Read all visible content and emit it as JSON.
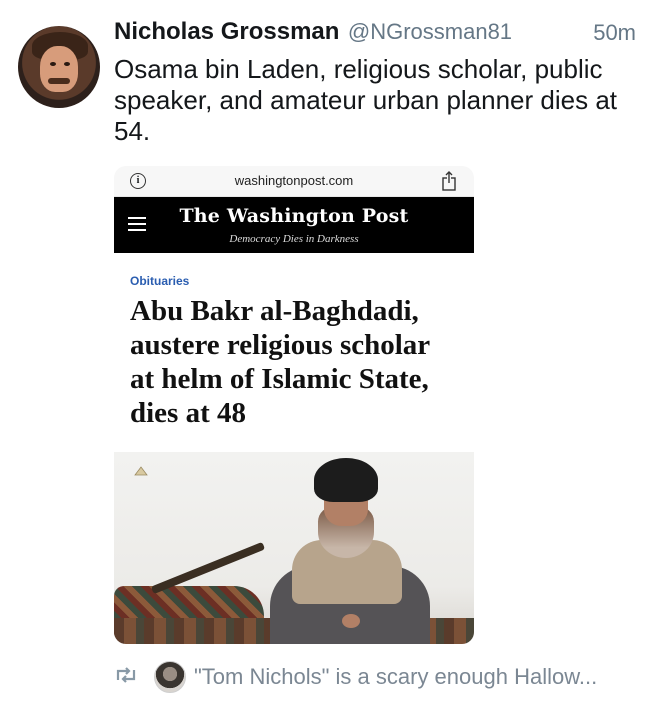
{
  "tweet": {
    "author_name": "Nicholas Grossman",
    "author_handle": "@NGrossman81",
    "timestamp": "50m",
    "text": "Osama bin Laden, religious scholar, public speaker, and amateur urban planner dies at 54."
  },
  "embedded_screenshot": {
    "browser_url": "washingtonpost.com",
    "masthead": "The Washington Post",
    "tagline": "Democracy Dies in Darkness",
    "section": "Obituaries",
    "headline": "Abu Bakr al-Baghdadi, austere religious scholar at helm of Islamic State, dies at 48"
  },
  "social_context": {
    "text": "\"Tom Nichols\" is a scary enough Hallow..."
  },
  "icons": {
    "info": "info-icon",
    "share": "share-icon",
    "menu": "hamburger-menu-icon",
    "retweet": "retweet-icon"
  },
  "colors": {
    "name": "#14171a",
    "muted": "#657786",
    "section": "#2a5db0",
    "retweet": "#8899a6"
  }
}
